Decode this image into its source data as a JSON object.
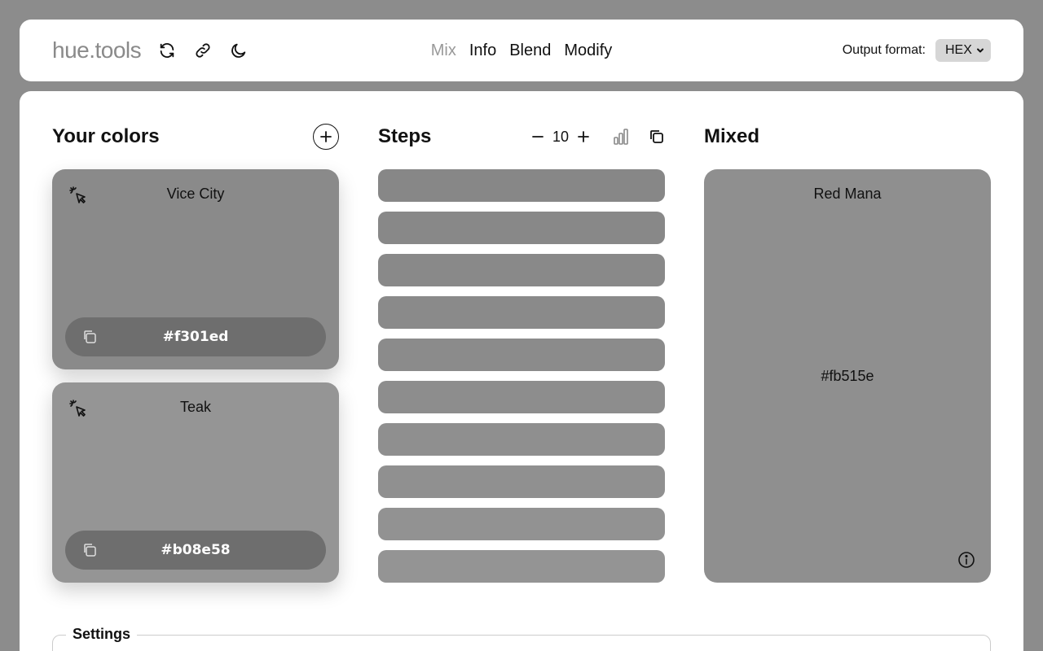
{
  "app": {
    "logo": "hue.tools",
    "toolbar_icons": [
      "refresh-icon",
      "link-icon",
      "moon-icon"
    ]
  },
  "nav": {
    "items": [
      {
        "label": "Mix",
        "active": true
      },
      {
        "label": "Info",
        "active": false
      },
      {
        "label": "Blend",
        "active": false
      },
      {
        "label": "Modify",
        "active": false
      }
    ]
  },
  "output": {
    "label": "Output format:",
    "selected": "HEX"
  },
  "colors": {
    "title": "Your colors",
    "items": [
      {
        "name": "Vice City",
        "hex": "#f301ed",
        "swatch": "#8a8a8a"
      },
      {
        "name": "Teak",
        "hex": "#b08e58",
        "swatch": "#959595"
      }
    ]
  },
  "steps": {
    "title": "Steps",
    "count": "10",
    "swatches": [
      "#878787",
      "#888888",
      "#898989",
      "#8a8a8a",
      "#8b8b8b",
      "#8d8d8d",
      "#8f8f8f",
      "#909090",
      "#929292",
      "#949494"
    ]
  },
  "mixed": {
    "title": "Mixed",
    "name": "Red Mana",
    "hex": "#fb515e"
  },
  "settings": {
    "title": "Settings"
  }
}
